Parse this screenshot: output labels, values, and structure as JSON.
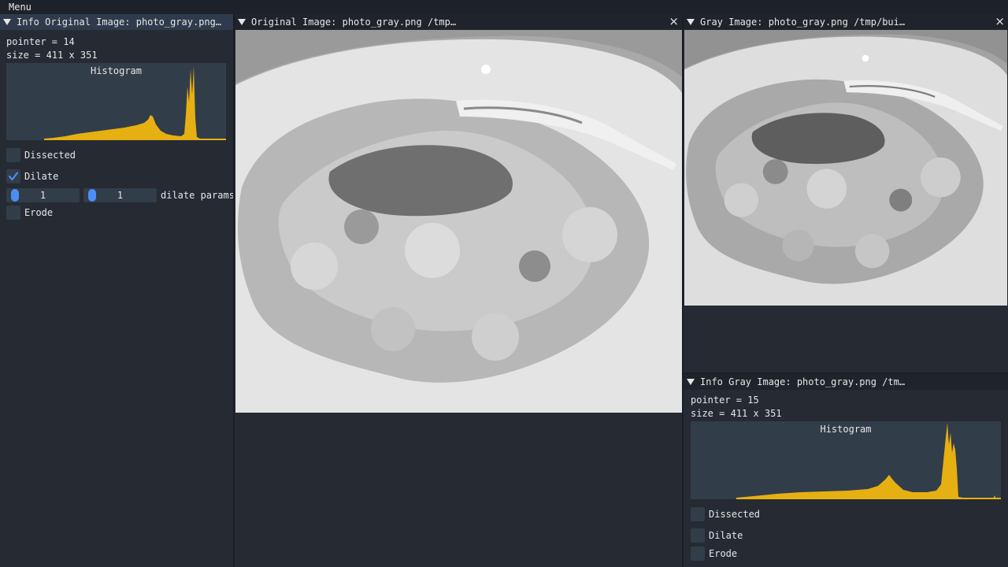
{
  "menubar": {
    "menu_label": "Menu"
  },
  "left_panel": {
    "title": "Info Original Image: photo_gray.png…",
    "pointer": "pointer = 14",
    "size": "size = 411 x 351",
    "histogram_title": "Histogram",
    "dissected_label": "Dissected",
    "dissected_checked": false,
    "dilate_label": "Dilate",
    "dilate_checked": true,
    "dilate_param_1": "1",
    "dilate_param_2": "1",
    "dilate_params_label": "dilate params",
    "erode_label": "Erode",
    "erode_checked": false
  },
  "center_panel": {
    "title": "Original Image: photo_gray.png /tmp…",
    "close_glyph": "×"
  },
  "right_top_panel": {
    "title": "Gray Image: photo_gray.png /tmp/bui…",
    "close_glyph": "×"
  },
  "right_bottom_panel": {
    "title": "Info Gray Image: photo_gray.png /tm…",
    "pointer": "pointer = 15",
    "size": "size = 411 x 351",
    "histogram_title": "Histogram",
    "dissected_label": "Dissected",
    "dilate_label": "Dilate",
    "erode_label": "Erode"
  },
  "colors": {
    "histogram_fill": "#e6b012",
    "checkbox_check": "#4c8df6",
    "slider_grab": "#4c8df6"
  }
}
